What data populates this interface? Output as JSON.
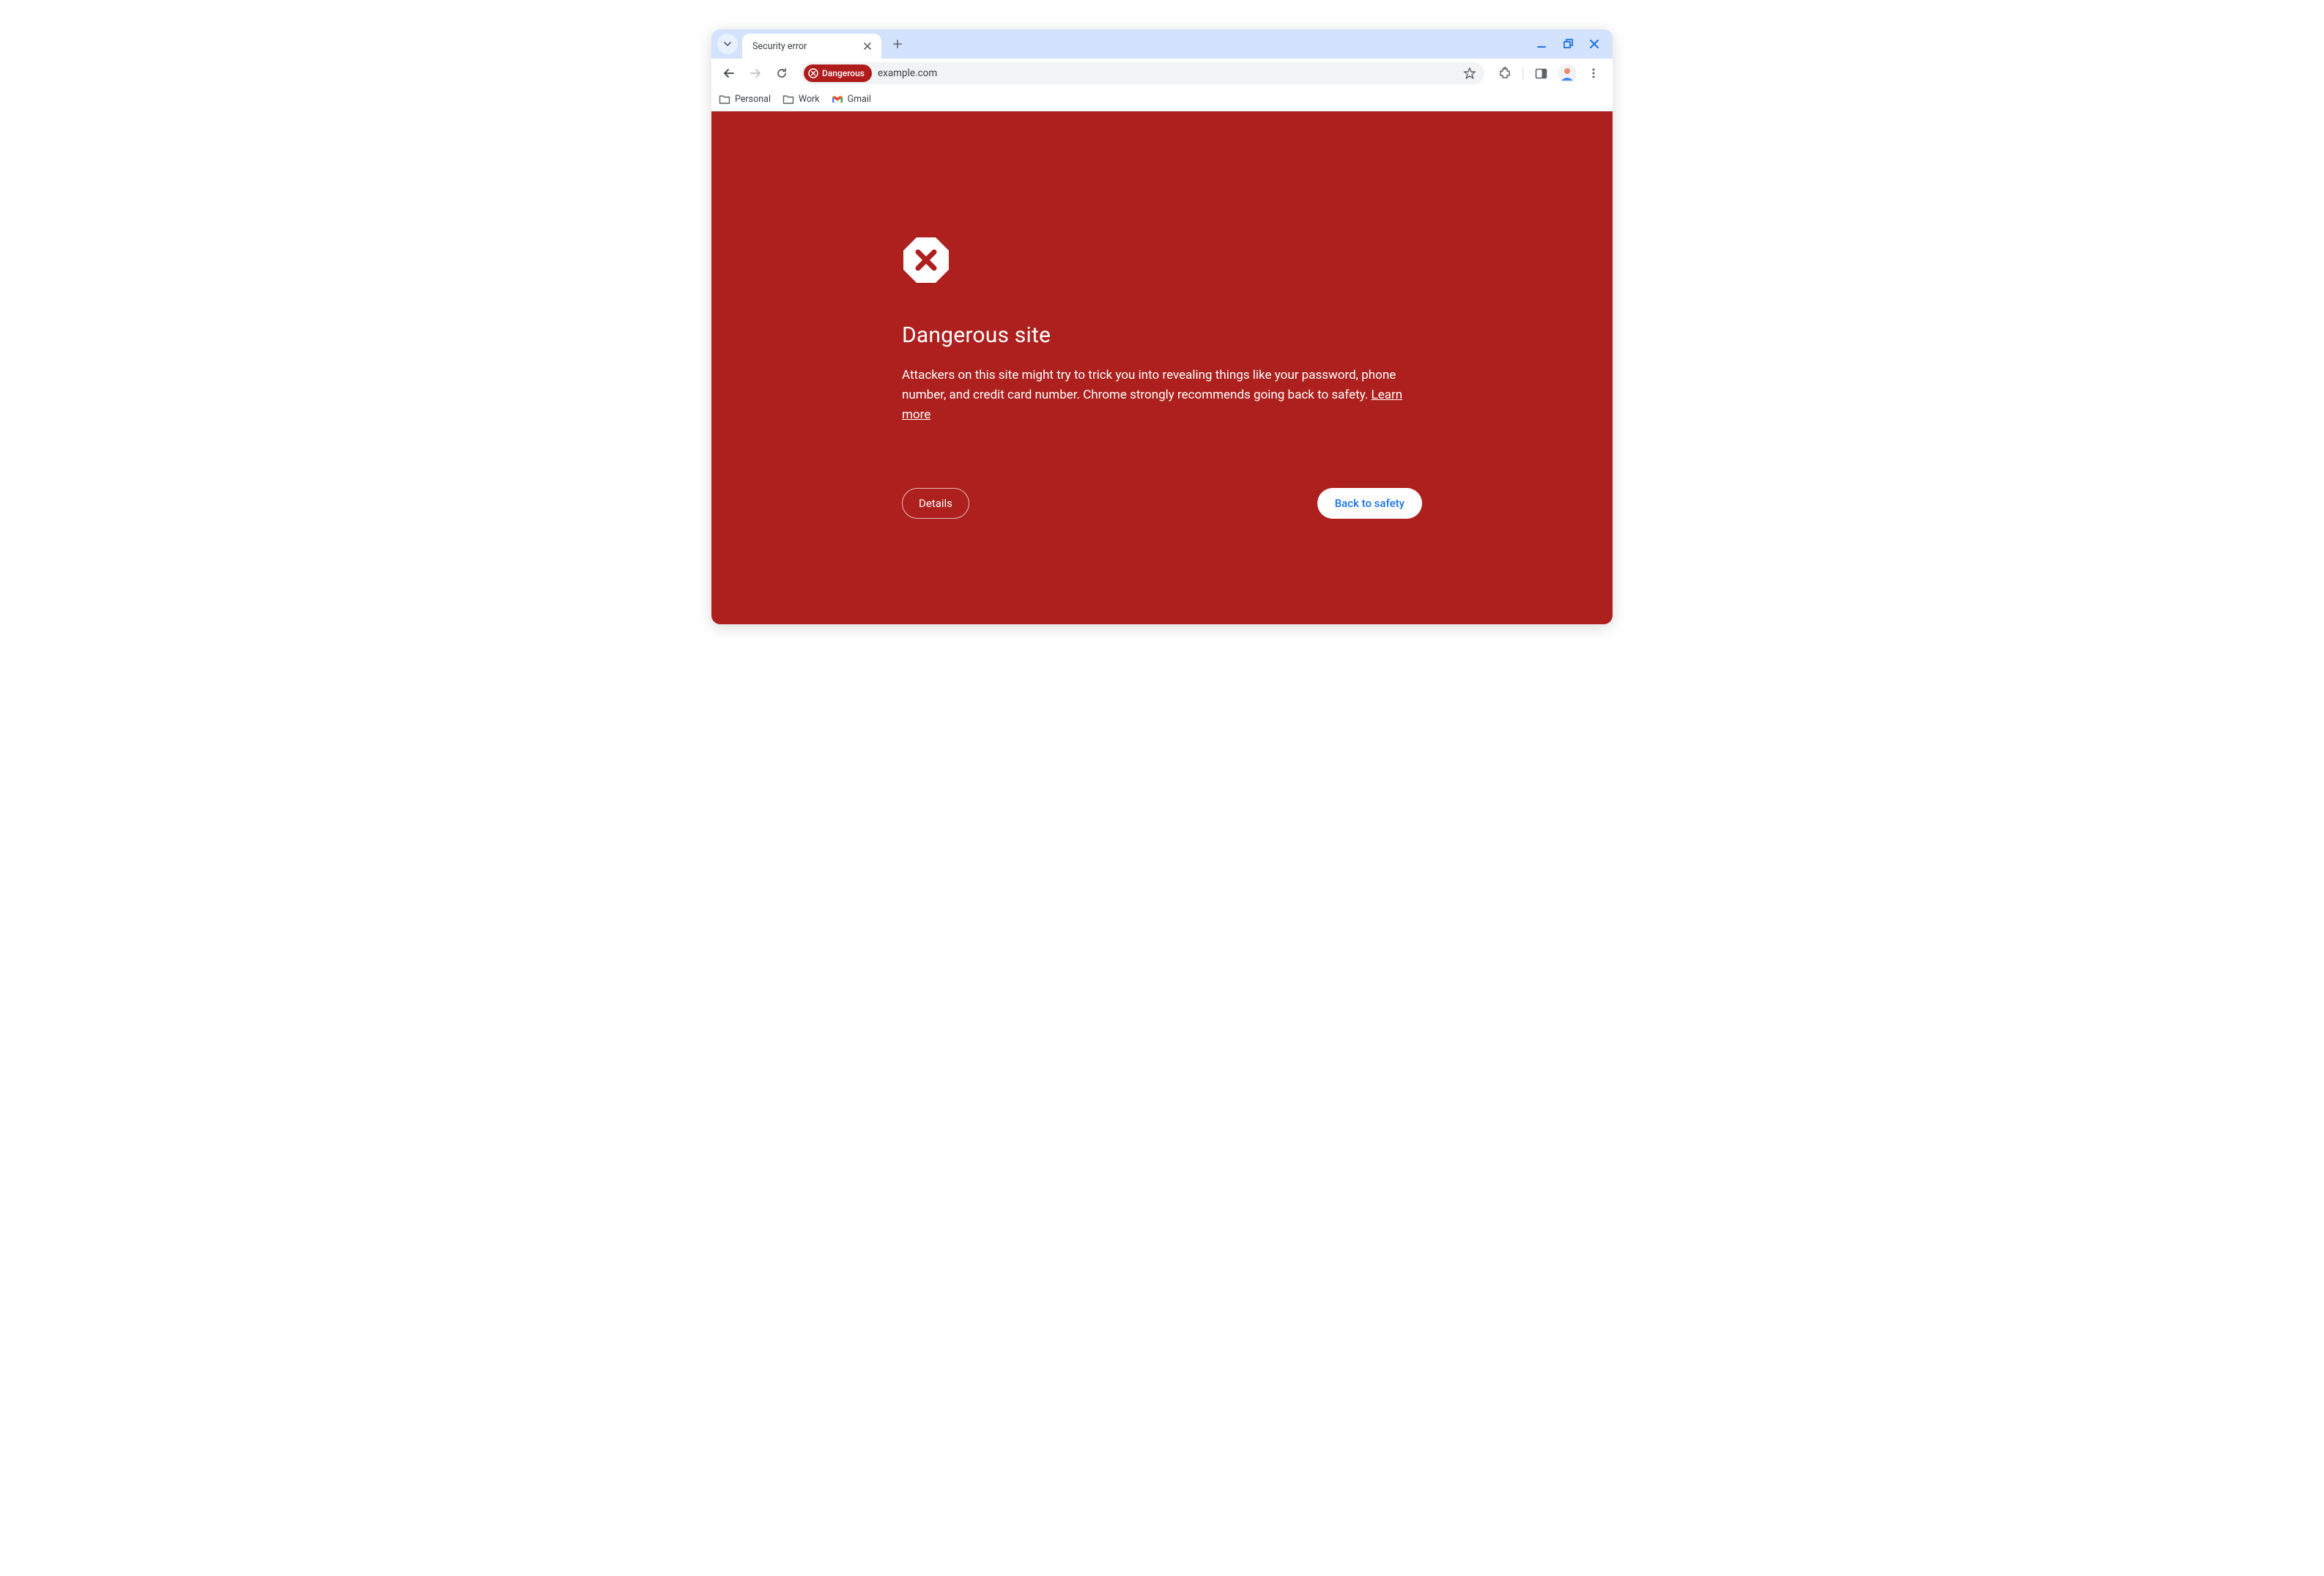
{
  "tab": {
    "title": "Security error"
  },
  "omnibox": {
    "chip_label": "Dangerous",
    "url": "example.com"
  },
  "bookmarks": [
    {
      "type": "folder",
      "label": "Personal"
    },
    {
      "type": "folder",
      "label": "Work"
    },
    {
      "type": "gmail",
      "label": "Gmail"
    }
  ],
  "warning": {
    "title": "Dangerous site",
    "body_prefix": "Attackers on this site might try to trick you into revealing things like your password, phone number, and credit card number. Chrome strongly recommends going back to safety. ",
    "learn_more": "Learn more",
    "details_button": "Details",
    "safety_button": "Back to safety"
  },
  "colors": {
    "danger_bg": "#ad201d",
    "chip_bg": "#b01c1c",
    "tab_strip": "#d3e2fd",
    "primary_blue": "#1a73e8"
  }
}
